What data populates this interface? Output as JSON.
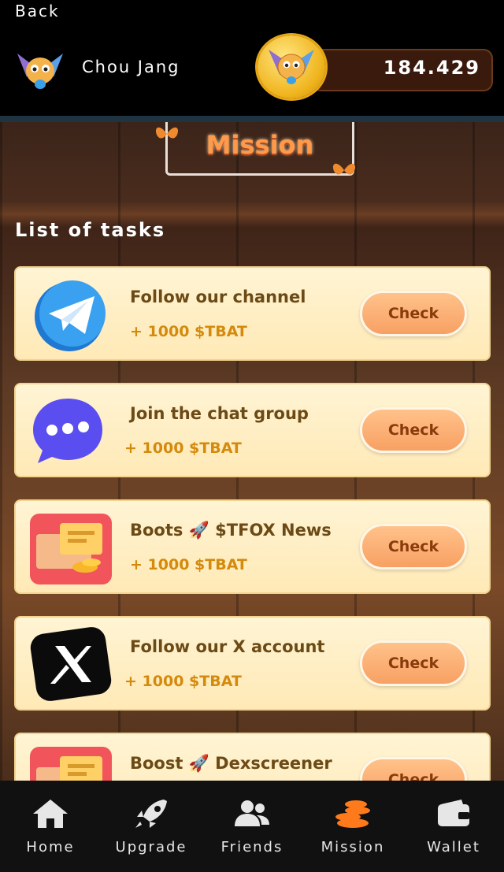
{
  "header": {
    "back_label": "Back",
    "username": "Chou Jang",
    "balance": "184.429"
  },
  "page": {
    "title": "Mission",
    "section_title": "List of tasks"
  },
  "tasks": [
    {
      "title": "Follow our channel",
      "reward": "+ 1000  $TBAT",
      "button": "Check",
      "icon": "telegram-icon"
    },
    {
      "title": "Join the chat group",
      "reward": "+ 1000 $TBAT",
      "button": "Check",
      "icon": "chat-bubble-icon"
    },
    {
      "title": "Boots 🚀 $TFOX News",
      "reward": "+ 1000 $TBAT",
      "button": "Check",
      "icon": "wallet-coins-icon"
    },
    {
      "title": "Follow our X account",
      "reward": "+ 1000 $TBAT",
      "button": "Check",
      "icon": "x-logo-icon"
    },
    {
      "title": "Boost 🚀 Dexscreener",
      "reward": "",
      "button": "Check",
      "icon": "wallet-coins-icon"
    }
  ],
  "nav": {
    "items": [
      {
        "label": "Home",
        "icon": "home-icon"
      },
      {
        "label": "Upgrade",
        "icon": "rocket-icon"
      },
      {
        "label": "Friends",
        "icon": "friends-icon"
      },
      {
        "label": "Mission",
        "icon": "coins-stack-icon",
        "active": true
      },
      {
        "label": "Wallet",
        "icon": "wallet-icon"
      }
    ],
    "active_color": "#ff7a1a"
  }
}
